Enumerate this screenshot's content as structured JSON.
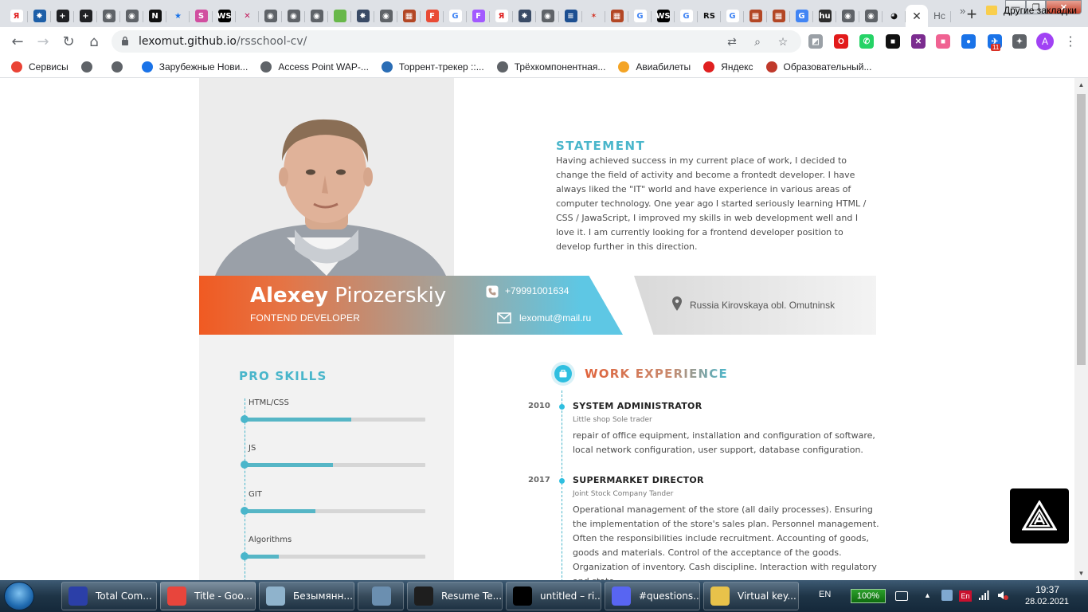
{
  "browser": {
    "tab_favicons": [
      {
        "icon": "yandex-icon",
        "glyph": "Я",
        "color": "#ffffff",
        "text": "#e02020"
      },
      {
        "icon": "app-icon",
        "glyph": "✸",
        "color": "#1d5fa8",
        "text": "#ffffff"
      },
      {
        "icon": "plus-square-icon",
        "glyph": "+",
        "color": "#202124",
        "text": "#ffffff"
      },
      {
        "icon": "plus-square-icon",
        "glyph": "+",
        "color": "#202124",
        "text": "#ffffff"
      },
      {
        "icon": "globe-icon",
        "glyph": "◉",
        "color": "#5f6368",
        "text": "#ffffff"
      },
      {
        "icon": "globe-icon",
        "glyph": "◉",
        "color": "#5f6368",
        "text": "#ffffff"
      },
      {
        "icon": "notion-icon",
        "glyph": "N",
        "color": "#111111",
        "text": "#ffffff"
      },
      {
        "icon": "star-icon",
        "glyph": "★",
        "color": "#dee1e6",
        "text": "#1a73e8"
      },
      {
        "icon": "app-icon",
        "glyph": "S",
        "color": "#d14fa0",
        "text": "#ffffff"
      },
      {
        "icon": "webstorm-icon",
        "glyph": "WS",
        "color": "#000000",
        "text": "#ffffff"
      },
      {
        "icon": "close-icon",
        "glyph": "✕",
        "color": "#dee1e6",
        "text": "#c2185b"
      },
      {
        "icon": "globe-icon",
        "glyph": "◉",
        "color": "#5f6368",
        "text": "#ffffff"
      },
      {
        "icon": "globe-icon",
        "glyph": "◉",
        "color": "#5f6368",
        "text": "#ffffff"
      },
      {
        "icon": "globe-icon",
        "glyph": "◉",
        "color": "#5f6368",
        "text": "#ffffff"
      },
      {
        "icon": "leaf-icon",
        "glyph": "●",
        "color": "#68b84a",
        "text": "#68b84a"
      },
      {
        "icon": "app-icon",
        "glyph": "✸",
        "color": "#3a4b66",
        "text": "#ffffff"
      },
      {
        "icon": "globe-icon",
        "glyph": "◉",
        "color": "#5f6368",
        "text": "#ffffff"
      },
      {
        "icon": "grid-icon",
        "glyph": "▦",
        "color": "#b34725",
        "text": "#ffffff"
      },
      {
        "icon": "figma-icon",
        "glyph": "F",
        "color": "#e94b35",
        "text": "#ffffff"
      },
      {
        "icon": "google-icon",
        "glyph": "G",
        "color": "#ffffff",
        "text": "#4285f4"
      },
      {
        "icon": "figma-icon",
        "glyph": "F",
        "color": "#a259ff",
        "text": "#ffffff"
      },
      {
        "icon": "yandex-icon",
        "glyph": "Я",
        "color": "#ffffff",
        "text": "#e02020"
      },
      {
        "icon": "app-icon",
        "glyph": "✸",
        "color": "#3a4b66",
        "text": "#ffffff"
      },
      {
        "icon": "globe-icon",
        "glyph": "◉",
        "color": "#5f6368",
        "text": "#ffffff"
      },
      {
        "icon": "stack-icon",
        "glyph": "≡",
        "color": "#1d4f91",
        "text": "#ffffff"
      },
      {
        "icon": "tool-icon",
        "glyph": "✶",
        "color": "#dee1e6",
        "text": "#d33a2c"
      },
      {
        "icon": "grid-icon",
        "glyph": "▦",
        "color": "#b34725",
        "text": "#ffffff"
      },
      {
        "icon": "google-icon",
        "glyph": "G",
        "color": "#ffffff",
        "text": "#4285f4"
      },
      {
        "icon": "webstorm-icon",
        "glyph": "WS",
        "color": "#000000",
        "text": "#ffffff"
      },
      {
        "icon": "google-icon",
        "glyph": "G",
        "color": "#ffffff",
        "text": "#4285f4"
      },
      {
        "icon": "rs-icon",
        "glyph": "RS",
        "color": "#dee1e6",
        "text": "#111111"
      },
      {
        "icon": "google-icon",
        "glyph": "G",
        "color": "#ffffff",
        "text": "#4285f4"
      },
      {
        "icon": "grid-icon",
        "glyph": "▦",
        "color": "#b34725",
        "text": "#ffffff"
      },
      {
        "icon": "grid-icon",
        "glyph": "▦",
        "color": "#b34725",
        "text": "#ffffff"
      },
      {
        "icon": "translate-icon",
        "glyph": "G",
        "color": "#4285f4",
        "text": "#ffffff"
      },
      {
        "icon": "app-icon",
        "glyph": "hu",
        "color": "#2d2d2d",
        "text": "#ffffff"
      },
      {
        "icon": "globe-icon",
        "glyph": "◉",
        "color": "#5f6368",
        "text": "#ffffff"
      },
      {
        "icon": "globe-icon",
        "glyph": "◉",
        "color": "#5f6368",
        "text": "#ffffff"
      },
      {
        "icon": "github-icon",
        "glyph": "◕",
        "color": "#dee1e6",
        "text": "#111111"
      }
    ],
    "active_tab_close": "✕",
    "next_tab_label": "Нс",
    "new_tab": "+",
    "window_controls": {
      "minimize": "—",
      "maximize": "❐",
      "close": "✕"
    },
    "nav": {
      "back": "←",
      "forward": "→",
      "reload": "↻",
      "home": "⌂"
    },
    "url_host": "lexomut.github.io",
    "url_path": "/rsschool-cv/",
    "omnibox_icons": {
      "translate": "⇄",
      "zoom": "⌕",
      "bookmark": "☆"
    },
    "extensions": [
      {
        "icon": "extension-icon",
        "glyph": "◩",
        "color": "#9aa0a6"
      },
      {
        "icon": "opera-icon",
        "glyph": "O",
        "color": "#e21b1b"
      },
      {
        "icon": "whatsapp-icon",
        "glyph": "✆",
        "color": "#25d366"
      },
      {
        "icon": "square-icon",
        "glyph": "■",
        "color": "#111111"
      },
      {
        "icon": "x-icon",
        "glyph": "✕",
        "color": "#7b2c8f"
      },
      {
        "icon": "gradient-icon",
        "glyph": "■",
        "color": "#f06292"
      },
      {
        "icon": "circle-icon",
        "glyph": "●",
        "color": "#1a73e8"
      },
      {
        "icon": "plane-icon",
        "glyph": "✈",
        "color": "#1a73e8"
      },
      {
        "icon": "puzzle-icon",
        "glyph": "✦",
        "color": "#5f6368"
      }
    ],
    "extension_badge": "11",
    "profile_initial": "A",
    "menu": "⋮"
  },
  "bookmarks": {
    "items": [
      {
        "icon": "apps-grid-icon",
        "label": "Сервисы",
        "color": "#ea4335"
      },
      {
        "icon": "globe-icon",
        "label": "",
        "color": "#5f6368"
      },
      {
        "icon": "globe-icon",
        "label": "",
        "color": "#5f6368"
      },
      {
        "icon": "ip-icon",
        "label": "Зарубежные Нови...",
        "color": "#1a73e8"
      },
      {
        "icon": "globe-icon",
        "label": "Access Point WAP-...",
        "color": "#5f6368"
      },
      {
        "icon": "torrent-icon",
        "label": "Торрент-трекер ::...",
        "color": "#2a6db5"
      },
      {
        "icon": "globe-icon",
        "label": "Трёхкомпонентная...",
        "color": "#5f6368"
      },
      {
        "icon": "plane-icon",
        "label": "Авиабилеты",
        "color": "#f4a425"
      },
      {
        "icon": "yandex-icon",
        "label": "Яндекс",
        "color": "#e02020"
      },
      {
        "icon": "school-icon",
        "label": "Образовательный...",
        "color": "#c0392b"
      }
    ],
    "more": "»",
    "other": "Другие закладки"
  },
  "cv": {
    "first_name": "Alexey",
    "last_name": "Pirozerskiy",
    "role": "FONTEND DEVELOPER",
    "phone": "+79991001634",
    "email": "lexomut@mail.ru",
    "location": "Russia Kirovskaya obl. Omutninsk",
    "statement_title": "STATEMENT",
    "statement_text": "Having achieved success in my current place of work, I decided to change the field of activity and become a frontedt developer. I have always liked the \"IT\" world and have experience in various areas of computer technology. One year ago I started seriously learning HTML / CSS / JawaScript, I improved my skills in web development well and I love it. I am currently looking for a frontend developer position to develop further in this direction.",
    "skills_title": "PRO SKILLS",
    "skills": [
      {
        "label": "HTML/CSS",
        "level": 0.59
      },
      {
        "label": "JS",
        "level": 0.49
      },
      {
        "label": "GIT",
        "level": 0.39
      },
      {
        "label": "Algorithms",
        "level": 0.19
      }
    ],
    "work_title": "WORK EXPERIENCE",
    "jobs": [
      {
        "year": "2010",
        "title": "SYSTEM ADMINISTRATOR",
        "company": "Little shop Sole trader",
        "description": "repair of office equipment, installation and configuration of software, local network configuration, user support, database configuration."
      },
      {
        "year": "2017",
        "title": "SUPERMARKET DIRECTOR",
        "company": "Joint Stock Company Tander",
        "description": "Operational management of the store (all daily processes). Ensuring the implementation of the store's sales plan. Personnel management. Often the responsibilities include recruitment. Accounting of goods, goods and materials. Control of the acceptance of the goods. Organization of inventory. Cash discipline. Interaction with regulatory and state"
      }
    ]
  },
  "taskbar": {
    "tasks": [
      {
        "label": "Total Com...",
        "icon_color": "#2b3fa8",
        "icon": "total-commander-icon"
      },
      {
        "label": "Title - Goo...",
        "icon_color": "#e8453c",
        "icon": "chrome-icon"
      },
      {
        "label": "Безымянн...",
        "icon_color": "#8fb3cc",
        "icon": "paint-icon"
      },
      {
        "label": "",
        "icon_color": "#6b8fb0",
        "icon": "calculator-icon"
      },
      {
        "label": "Resume Te...",
        "icon_color": "#1e1e1e",
        "icon": "figma-icon"
      },
      {
        "label": "untitled – ri...",
        "icon_color": "#000000",
        "icon": "webstorm-icon"
      },
      {
        "label": "#questions...",
        "icon_color": "#5865f2",
        "icon": "discord-icon"
      },
      {
        "label": "Virtual key...",
        "icon_color": "#e8c24a",
        "icon": "folder-icon"
      }
    ],
    "language": "EN",
    "battery": "100%",
    "keyboard_lang": "En",
    "time": "19:37",
    "date": "28.02.2021"
  }
}
